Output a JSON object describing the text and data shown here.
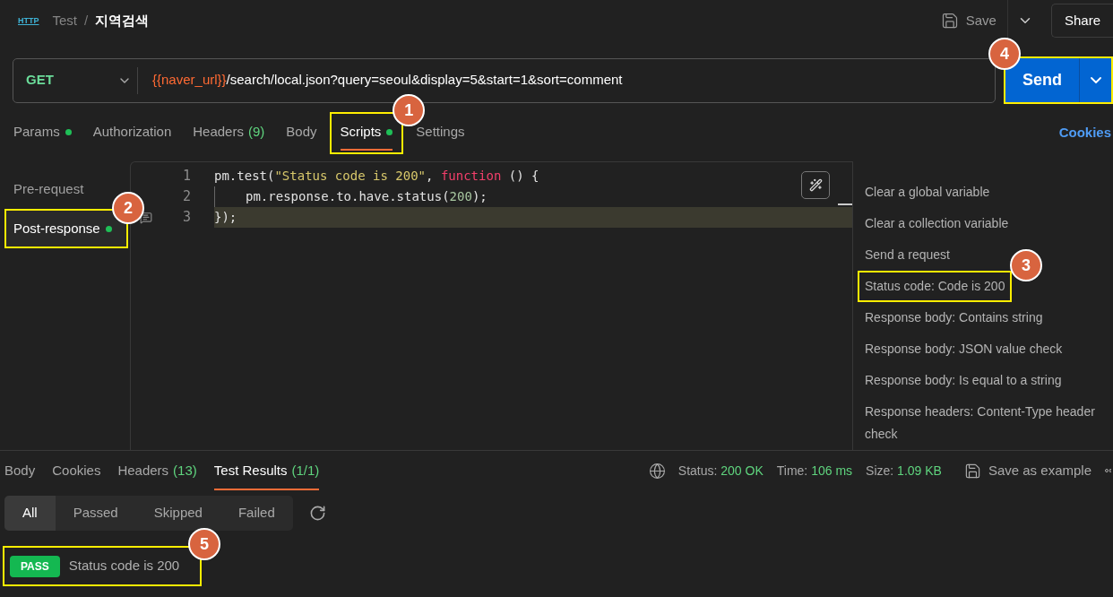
{
  "header": {
    "icon": "HTTP",
    "separator": "/",
    "breadcrumb": [
      {
        "label": "Test",
        "current": false
      },
      {
        "label": "지역검색",
        "current": true
      }
    ],
    "save": "Save",
    "share": "Share"
  },
  "request": {
    "method": "GET",
    "url_variable": "{{naver_url}}",
    "url_path": "/search/local.json?query=seoul&display=5&start=1&sort=comment",
    "send": "Send",
    "callout": "4"
  },
  "request_tabs": [
    {
      "label": "Params",
      "dot": true,
      "selected": false
    },
    {
      "label": "Authorization",
      "dot": false,
      "selected": false
    },
    {
      "label": "Headers",
      "count": "(9)",
      "dot": false,
      "selected": false
    },
    {
      "label": "Body",
      "dot": false,
      "selected": false
    },
    {
      "label": "Scripts",
      "dot": true,
      "selected": true,
      "callout": "1"
    },
    {
      "label": "Settings",
      "dot": false,
      "selected": false
    }
  ],
  "cookies_link": "Cookies",
  "script_tabs": [
    {
      "label": "Pre-request",
      "dot": false,
      "selected": false
    },
    {
      "label": "Post-response",
      "dot": true,
      "selected": true,
      "callout": "2"
    }
  ],
  "editor": {
    "lines": [
      {
        "number": "1",
        "active": false,
        "indent": false,
        "tokens": [
          {
            "kind": "plain",
            "text": "pm.test("
          },
          {
            "kind": "string",
            "text": "\"Status code is 200\""
          },
          {
            "kind": "plain",
            "text": ", "
          },
          {
            "kind": "keyword",
            "text": "function"
          },
          {
            "kind": "plain",
            "text": " () {"
          }
        ]
      },
      {
        "number": "2",
        "active": false,
        "indent": true,
        "tokens": [
          {
            "kind": "plain",
            "text": "pm.response.to.have.status("
          },
          {
            "kind": "number",
            "text": "200"
          },
          {
            "kind": "plain",
            "text": ");"
          }
        ]
      },
      {
        "number": "3",
        "active": true,
        "indent": false,
        "tokens": [
          {
            "kind": "plain",
            "text": "});"
          }
        ]
      }
    ]
  },
  "snippets": [
    {
      "label": "Clear a global variable"
    },
    {
      "label": "Clear a collection variable"
    },
    {
      "label": "Send a request"
    },
    {
      "label": "Status code: Code is 200",
      "callout": "3"
    },
    {
      "label": "Response body: Contains string"
    },
    {
      "label": "Response body: JSON value check"
    },
    {
      "label": "Response body: Is equal to a string"
    },
    {
      "label": "Response headers: Content-Type header check"
    }
  ],
  "response_tabs": [
    {
      "label": "Body",
      "selected": false
    },
    {
      "label": "Cookies",
      "selected": false
    },
    {
      "label": "Headers",
      "count": "(13)",
      "selected": false
    },
    {
      "label": "Test Results",
      "count": "(1/1)",
      "selected": true
    }
  ],
  "response_meta": [
    {
      "label": "Status:",
      "value": "200 OK"
    },
    {
      "label": "Time:",
      "value": "106 ms"
    },
    {
      "label": "Size:",
      "value": "1.09 KB"
    }
  ],
  "save_example": "Save as example",
  "filters": [
    {
      "label": "All",
      "selected": true
    },
    {
      "label": "Passed",
      "selected": false
    },
    {
      "label": "Skipped",
      "selected": false
    },
    {
      "label": "Failed",
      "selected": false
    }
  ],
  "results": [
    {
      "kind": "pass",
      "status": "PASS",
      "name": "Status code is 200",
      "callout": "5"
    }
  ]
}
